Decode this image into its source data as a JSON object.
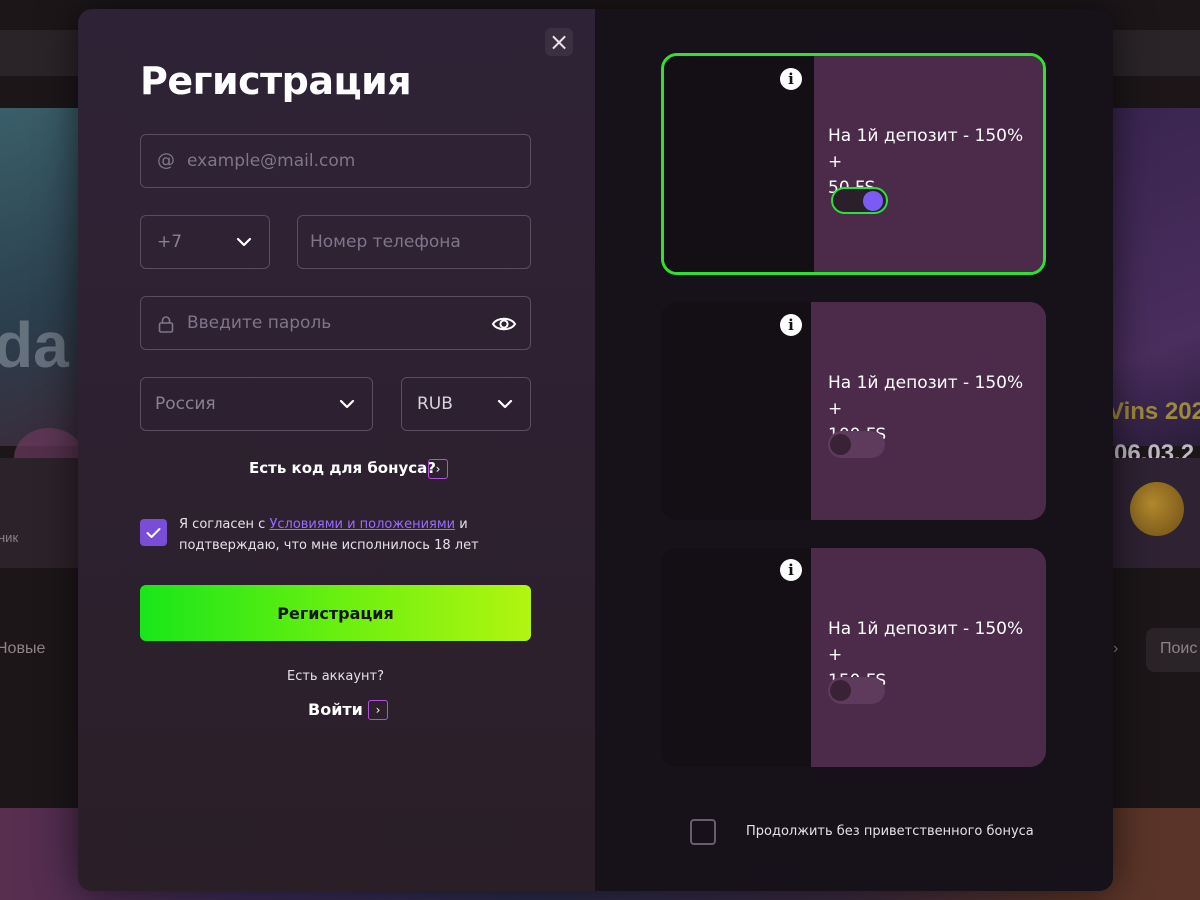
{
  "background": {
    "banner_left_text": "da",
    "banner_right_line1": "Vins 202",
    "banner_right_line2": "06.03.2",
    "row_card_label": "ник",
    "tab_left": "Новые",
    "tab_right": "Поис",
    "tab_arrow": "›"
  },
  "modal": {
    "title": "Регистрация",
    "close_icon": "close-icon",
    "email": {
      "icon": "at-icon",
      "placeholder": "example@mail.com",
      "value": ""
    },
    "phone_code": {
      "value": "+7",
      "icon": "chevron-down-icon"
    },
    "phone": {
      "placeholder": "Номер телефона",
      "value": ""
    },
    "password": {
      "icon": "lock-icon",
      "placeholder": "Введите пароль",
      "value": "",
      "toggle_icon": "eye-icon"
    },
    "country": {
      "value": "Россия",
      "icon": "chevron-down-icon"
    },
    "currency": {
      "value": "RUB",
      "icon": "chevron-down-icon"
    },
    "bonus_code_label": "Есть код для бонуса?",
    "agree": {
      "checked": true,
      "text_before": "Я согласен с ",
      "link": "Условиями и положениями",
      "text_after": " и подтверждаю, что мне исполнилось 18 лет"
    },
    "register_button": "Регистрация",
    "has_account": "Есть аккаунт?",
    "login_link": "Войти",
    "accent_green": "#2ee32f",
    "accent_purple": "#7a4dd8"
  },
  "bonuses": [
    {
      "line1": "На 1й депозит - 150% +",
      "line2": "50 FS",
      "enabled": true,
      "selected": true,
      "info_icon": "info-icon",
      "info_glyph": "i"
    },
    {
      "line1": "На 1й депозит - 150% +",
      "line2": "100 FS",
      "enabled": false,
      "selected": false,
      "info_icon": "info-icon",
      "info_glyph": "i"
    },
    {
      "line1": "На 1й депозит - 150% +",
      "line2": "150 FS",
      "enabled": false,
      "selected": false,
      "info_icon": "info-icon",
      "info_glyph": "i"
    }
  ],
  "no_bonus": {
    "checked": false,
    "label": "Продолжить без приветственного бонуса"
  }
}
